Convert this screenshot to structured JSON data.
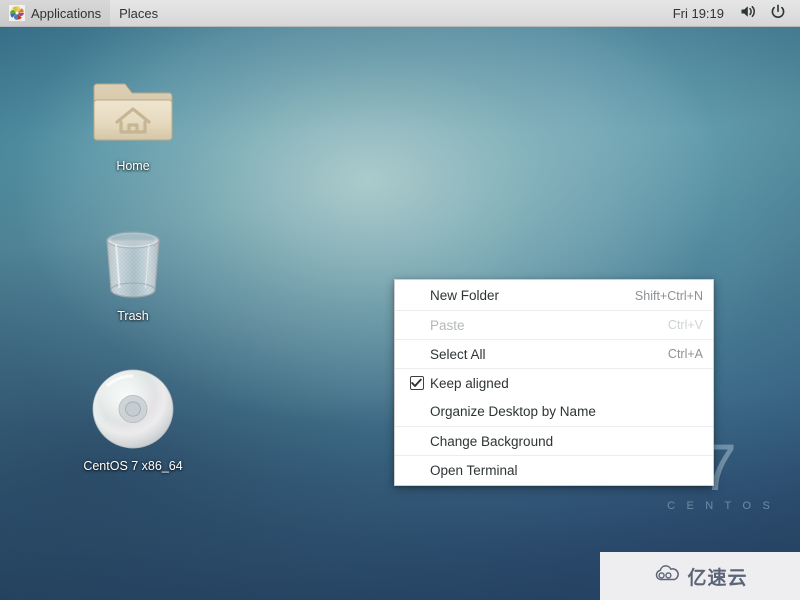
{
  "panel": {
    "applications_label": "Applications",
    "places_label": "Places",
    "clock": "Fri 19:19",
    "volume_icon": "speaker-volume-icon",
    "power_icon": "power-icon",
    "applications_icon": "pinwheel-icon"
  },
  "desktop": {
    "icons": [
      {
        "name": "home",
        "label": "Home",
        "icon": "home-folder-icon"
      },
      {
        "name": "trash",
        "label": "Trash",
        "icon": "trash-bin-icon"
      },
      {
        "name": "cdrom",
        "label": "CentOS 7 x86_64",
        "icon": "optical-disc-icon"
      }
    ],
    "watermark_version": "7",
    "watermark_word": "C E N T O S"
  },
  "context_menu": {
    "items": [
      {
        "label": "New Folder",
        "accel": "Shift+Ctrl+N",
        "disabled": false,
        "checkbox": false,
        "separator_above": false
      },
      {
        "label": "Paste",
        "accel": "Ctrl+V",
        "disabled": true,
        "checkbox": false,
        "separator_above": true
      },
      {
        "label": "Select All",
        "accel": "Ctrl+A",
        "disabled": false,
        "checkbox": false,
        "separator_above": true
      },
      {
        "label": "Keep aligned",
        "accel": "",
        "disabled": false,
        "checkbox": true,
        "checked": true,
        "separator_above": true
      },
      {
        "label": "Organize Desktop by Name",
        "accel": "",
        "disabled": false,
        "checkbox": false,
        "separator_above": false
      },
      {
        "label": "Change Background",
        "accel": "",
        "disabled": false,
        "checkbox": false,
        "separator_above": true
      },
      {
        "label": "Open Terminal",
        "accel": "",
        "disabled": false,
        "checkbox": false,
        "separator_above": true
      }
    ]
  },
  "overlay_watermark": {
    "text": "亿速云",
    "icon": "cloud-logo-icon"
  },
  "colors": {
    "panel_bg": "#e0e0e0",
    "menu_bg": "#ffffff",
    "desktop_teal": "#4e8398",
    "desktop_deep_blue": "#2f4f72",
    "accel_text": "#8c9294",
    "watermark_bg": "#eeeef0"
  }
}
